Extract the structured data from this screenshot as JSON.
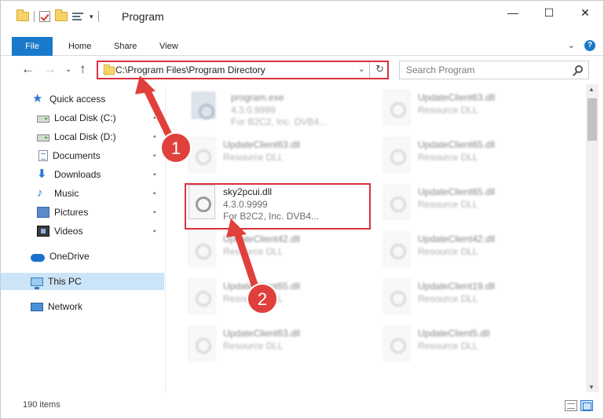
{
  "window": {
    "title": "Program",
    "minimize_glyph": "—",
    "maximize_glyph": "☐",
    "close_glyph": "✕",
    "qat_dropdown_glyph": "▾"
  },
  "ribbon": {
    "tabs": [
      "File",
      "Home",
      "Share",
      "View"
    ],
    "expand_glyph": "⌄",
    "help_glyph": "?"
  },
  "nav": {
    "back_glyph": "←",
    "forward_glyph": "→",
    "recent_glyph": "⌄",
    "up_glyph": "↑",
    "address": "C:\\Program Files\\Program Directory",
    "address_dropdown_glyph": "⌄",
    "refresh_glyph": "↻",
    "search_placeholder": "Search Program"
  },
  "sidebar": {
    "pin_glyph": "📌",
    "items": [
      {
        "label": "Quick access",
        "icon": "star-icon"
      },
      {
        "label": "Local Disk (C:)",
        "icon": "disk-icon"
      },
      {
        "label": "Local Disk (D:)",
        "icon": "disk-icon"
      },
      {
        "label": "Documents",
        "icon": "documents-icon"
      },
      {
        "label": "Downloads",
        "icon": "download-arrow-icon",
        "glyph": "⬇"
      },
      {
        "label": "Music",
        "icon": "music-note-icon",
        "glyph": "♪"
      },
      {
        "label": "Pictures",
        "icon": "pictures-icon"
      },
      {
        "label": "Videos",
        "icon": "film-icon"
      },
      {
        "label": "OneDrive",
        "icon": "cloud-icon"
      },
      {
        "label": "This PC",
        "icon": "computer-icon"
      },
      {
        "label": "Network",
        "icon": "network-icon"
      }
    ],
    "star_glyph": "★"
  },
  "files": [
    {
      "name": "program.exe",
      "meta1": "4.3.0.9999",
      "meta2": "For B2C2, Inc. DVB4..."
    },
    {
      "name": "UpdateClient63.dll",
      "meta1": "Resource DLL"
    },
    {
      "name": "UpdateClient63.dll",
      "meta1": "Resource DLL"
    },
    {
      "name": "UpdateClient65.dll",
      "meta1": "Resource DLL"
    },
    {
      "name": "sky2pcui.dll",
      "meta1": "4.3.0.9999",
      "meta2": "For B2C2, Inc. DVB4..."
    },
    {
      "name": "UpdateClient65.dll",
      "meta1": "Resource DLL"
    },
    {
      "name": "UpdateClient42.dll",
      "meta1": "Resource DLL"
    },
    {
      "name": "UpdateClient42.dll",
      "meta1": "Resource DLL"
    },
    {
      "name": "UpdateClient65.dll",
      "meta1": "Resource DLL"
    },
    {
      "name": "UpdateClient19.dll",
      "meta1": "Resource DLL"
    },
    {
      "name": "UpdateClient63.dll",
      "meta1": "Resource DLL"
    },
    {
      "name": "UpdateClient5.dll",
      "meta1": "Resource DLL"
    }
  ],
  "scroll": {
    "up_glyph": "▲",
    "down_glyph": "▼"
  },
  "status": {
    "item_count": "190 items"
  },
  "annotations": {
    "step1": "1",
    "step2": "2",
    "colors": {
      "red": "#d8323d",
      "badge": "#e0403c",
      "accent": "#1979ca"
    }
  }
}
